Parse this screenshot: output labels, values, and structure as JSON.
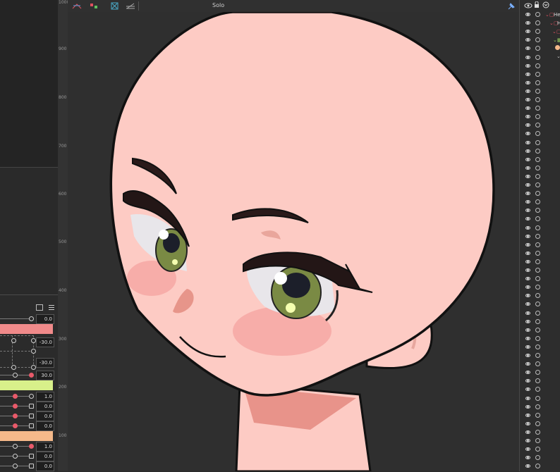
{
  "toolbar": {
    "solo_label": "Solo"
  },
  "ruler": {
    "labels": [
      "1000",
      "900",
      "800",
      "700",
      "600",
      "500",
      "400",
      "300",
      "200",
      "100"
    ]
  },
  "params": {
    "values": [
      "0.0",
      "-30.0",
      "-30.0",
      "30.0",
      "1.0",
      "0.0",
      "0.0",
      "0.0",
      "1.0",
      "0.0",
      "0.0"
    ]
  },
  "layers": {
    "items": [
      "Hea",
      "H",
      ""
    ]
  },
  "colors": {
    "skin": "#fdcbc4",
    "outline": "#111111",
    "band_pink": "#f08a8a",
    "band_green": "#d8f08a",
    "band_orange": "#f5b98a"
  }
}
